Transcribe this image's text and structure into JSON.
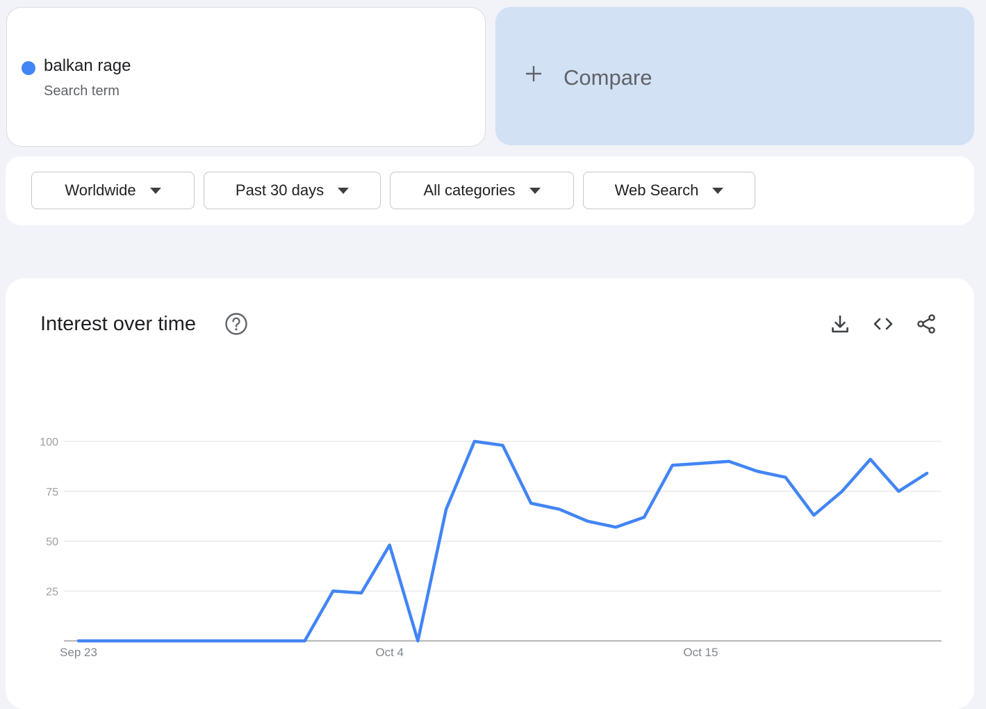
{
  "search_term": {
    "name": "balkan rage",
    "subtitle": "Search term",
    "color": "#4285f4"
  },
  "compare": {
    "label": "Compare"
  },
  "filters": [
    {
      "label": "Worldwide"
    },
    {
      "label": "Past 30 days"
    },
    {
      "label": "All categories"
    },
    {
      "label": "Web Search"
    }
  ],
  "panel": {
    "title": "Interest over time",
    "icons": [
      "help-icon",
      "download-icon",
      "embed-code-icon",
      "share-icon"
    ]
  },
  "chart_data": {
    "type": "line",
    "title": "",
    "xlabel": "",
    "ylabel": "",
    "ylim": [
      0,
      100
    ],
    "y_ticks": [
      100,
      75,
      50,
      25
    ],
    "x_tick_labels": [
      {
        "label": "Sep 23",
        "index": 0
      },
      {
        "label": "Oct 4",
        "index": 11
      },
      {
        "label": "Oct 15",
        "index": 22
      }
    ],
    "grid": true,
    "line_color": "#4285f4",
    "x": [
      "Sep 23",
      "Sep 24",
      "Sep 25",
      "Sep 26",
      "Sep 27",
      "Sep 28",
      "Sep 29",
      "Sep 30",
      "Oct 1",
      "Oct 2",
      "Oct 3",
      "Oct 4",
      "Oct 5",
      "Oct 6",
      "Oct 7",
      "Oct 8",
      "Oct 9",
      "Oct 10",
      "Oct 11",
      "Oct 12",
      "Oct 13",
      "Oct 14",
      "Oct 15",
      "Oct 16",
      "Oct 17",
      "Oct 18",
      "Oct 19",
      "Oct 20",
      "Oct 21",
      "Oct 22",
      "Oct 23"
    ],
    "series": [
      {
        "values": [
          0,
          0,
          0,
          0,
          0,
          0,
          0,
          0,
          0,
          25,
          24,
          48,
          0,
          66,
          100,
          98,
          69,
          66,
          60,
          57,
          62,
          88,
          89,
          90,
          85,
          82,
          63,
          75,
          91,
          75,
          84
        ]
      }
    ]
  }
}
